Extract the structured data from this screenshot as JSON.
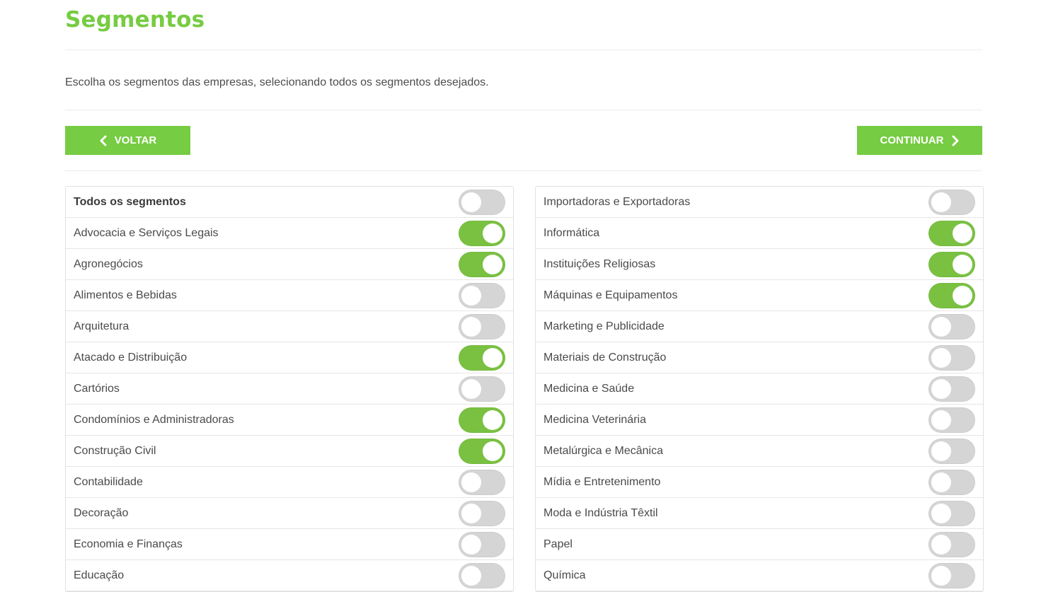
{
  "page": {
    "title": "Segmentos",
    "description": "Escolha os segmentos das empresas, selecionando todos os segmentos desejados.",
    "back_label": "VOLTAR",
    "next_label": "CONTINUAR"
  },
  "colors": {
    "accent": "#76cc42",
    "toggle_on": "#7ac142",
    "toggle_off": "#d5d5d5"
  },
  "left_segments": [
    {
      "label": "Todos os segmentos",
      "on": false,
      "bold": true
    },
    {
      "label": "Advocacia e Serviços Legais",
      "on": true
    },
    {
      "label": "Agronegócios",
      "on": true
    },
    {
      "label": "Alimentos e Bebidas",
      "on": false
    },
    {
      "label": "Arquitetura",
      "on": false
    },
    {
      "label": "Atacado e Distribuição",
      "on": true
    },
    {
      "label": "Cartórios",
      "on": false
    },
    {
      "label": "Condomínios e Administradoras",
      "on": true
    },
    {
      "label": "Construção Civil",
      "on": true
    },
    {
      "label": "Contabilidade",
      "on": false
    },
    {
      "label": "Decoração",
      "on": false
    },
    {
      "label": "Economia e Finanças",
      "on": false
    },
    {
      "label": "Educação",
      "on": false
    }
  ],
  "right_segments": [
    {
      "label": "Importadoras e Exportadoras",
      "on": false
    },
    {
      "label": "Informática",
      "on": true
    },
    {
      "label": "Instituições Religiosas",
      "on": true
    },
    {
      "label": "Máquinas e Equipamentos",
      "on": true
    },
    {
      "label": "Marketing e Publicidade",
      "on": false
    },
    {
      "label": "Materiais de Construção",
      "on": false
    },
    {
      "label": "Medicina e Saúde",
      "on": false
    },
    {
      "label": "Medicina Veterinária",
      "on": false
    },
    {
      "label": "Metalúrgica e Mecânica",
      "on": false
    },
    {
      "label": "Mídia e Entretenimento",
      "on": false
    },
    {
      "label": "Moda e Indústria Têxtil",
      "on": false
    },
    {
      "label": "Papel",
      "on": false
    },
    {
      "label": "Química",
      "on": false
    }
  ]
}
